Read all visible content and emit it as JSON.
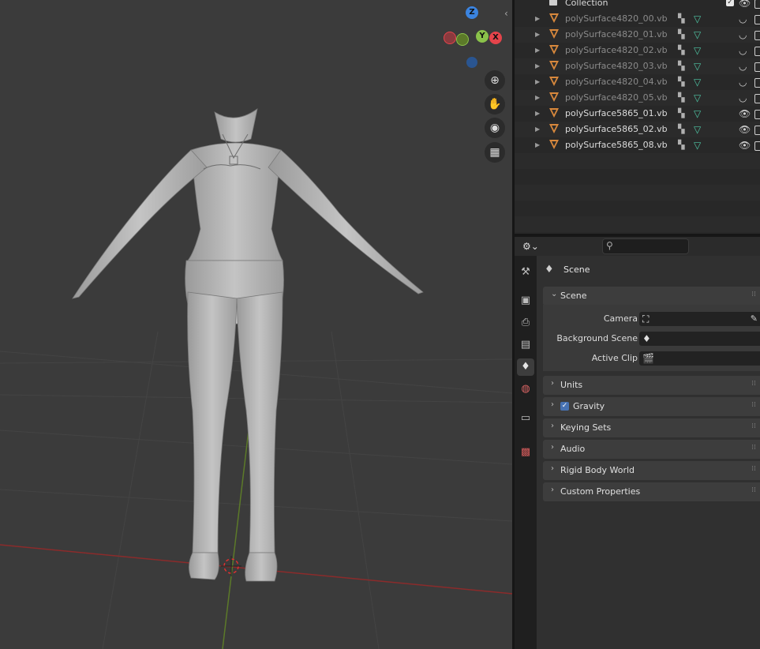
{
  "viewport": {
    "gizmo": {
      "axes": [
        "Z",
        "Y",
        "X"
      ],
      "colors": {
        "x": "#e5444b",
        "y": "#8ac24a",
        "z": "#3b84e0"
      }
    },
    "nav_icons": [
      "zoom-icon",
      "hand-pan-icon",
      "camera-icon",
      "grid-ortho-icon"
    ]
  },
  "outliner": {
    "collection": {
      "name": "Collection"
    },
    "items": [
      {
        "name": "polySurface4820_00.vb",
        "visible": false
      },
      {
        "name": "polySurface4820_01.vb",
        "visible": false
      },
      {
        "name": "polySurface4820_02.vb",
        "visible": false
      },
      {
        "name": "polySurface4820_03.vb",
        "visible": false
      },
      {
        "name": "polySurface4820_04.vb",
        "visible": false
      },
      {
        "name": "polySurface4820_05.vb",
        "visible": false
      },
      {
        "name": "polySurface5865_01.vb",
        "visible": true
      },
      {
        "name": "polySurface5865_02.vb",
        "visible": true
      },
      {
        "name": "polySurface5865_08.vb",
        "visible": true
      }
    ]
  },
  "properties": {
    "search": {
      "placeholder": ""
    },
    "context": {
      "label": "Scene"
    },
    "scene_panel": {
      "title": "Scene",
      "camera_label": "Camera",
      "background_scene_label": "Background Scene",
      "active_clip_label": "Active Clip"
    },
    "panels": {
      "units": "Units",
      "gravity": "Gravity",
      "keying_sets": "Keying Sets",
      "audio": "Audio",
      "rigid_body_world": "Rigid Body World",
      "custom_properties": "Custom Properties"
    },
    "gravity_enabled": true,
    "tabs": [
      "tool-icon",
      "render-icon",
      "output-icon",
      "view-layer-icon",
      "scene-icon",
      "world-icon",
      "collection-icon",
      "texture-icon"
    ]
  }
}
